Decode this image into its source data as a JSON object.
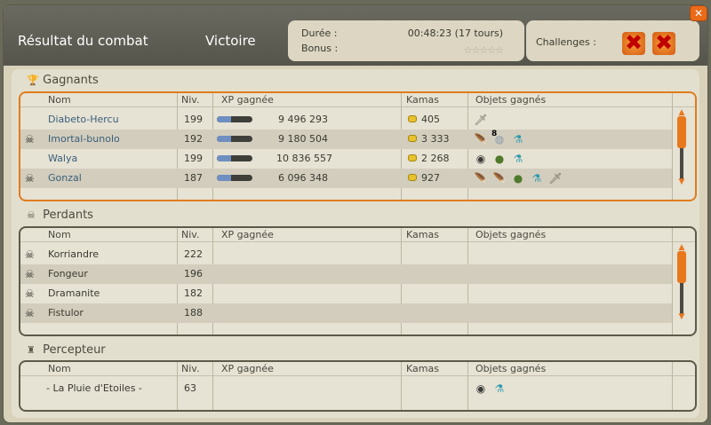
{
  "header": {
    "title": "Résultat du combat",
    "result": "Victoire",
    "duration_label": "Durée :",
    "duration_value": "00:48:23 (17 tours)",
    "bonus_label": "Bonus :",
    "bonus_stars": "☆☆☆☆☆",
    "challenges_label": "Challenges :",
    "challenge_failed_symbol": "✖"
  },
  "close_label": "✕",
  "columns": {
    "name": "Nom",
    "level": "Niv.",
    "xp": "XP gagnée",
    "kamas": "Kamas",
    "objects": "Objets gagnés"
  },
  "winners": {
    "title": "Gagnants",
    "icon": "trophy-icon",
    "rows": [
      {
        "name": "Diabeto-Hercu",
        "dead": false,
        "level": "199",
        "xp": "9 496 293",
        "xp_fill": 0.4,
        "kamas": "405",
        "items": [
          "🗡"
        ],
        "item_count": ""
      },
      {
        "name": "Imortal-bunolo",
        "dead": true,
        "level": "192",
        "xp": "9 180 504",
        "xp_fill": 0.4,
        "kamas": "3 333",
        "items": [
          "🪶",
          "◍",
          "⚗"
        ],
        "item_count": "8"
      },
      {
        "name": "Walya",
        "dead": false,
        "level": "199",
        "xp": "10 836 557",
        "xp_fill": 0.4,
        "kamas": "2 268",
        "items": [
          "◉",
          "●",
          "⚗"
        ],
        "item_count": ""
      },
      {
        "name": "Gonzal",
        "dead": true,
        "level": "187",
        "xp": "6 096 348",
        "xp_fill": 0.4,
        "kamas": "927",
        "items": [
          "🪶",
          "🪶",
          "●",
          "⚗",
          "🗡"
        ],
        "item_count": ""
      }
    ]
  },
  "losers": {
    "title": "Perdants",
    "icon": "skull-crossbones-icon",
    "rows": [
      {
        "name": "Korriandre",
        "level": "222"
      },
      {
        "name": "Fongeur",
        "level": "196"
      },
      {
        "name": "Dramanite",
        "level": "182"
      },
      {
        "name": "Fistulor",
        "level": "188"
      }
    ]
  },
  "collector": {
    "title": "Percepteur",
    "icon": "money-bag-icon",
    "columns_objects": "Objets gagnés",
    "rows": [
      {
        "name": "- La Pluie d'Etoiles -",
        "level": "63",
        "items": [
          "◉",
          "⚗"
        ]
      }
    ]
  },
  "colors": {
    "accent": "#e07c1e",
    "name_link": "#3a5f7a",
    "challenge_failed": "#c00000",
    "xp_bar": "#6e8fc0"
  }
}
